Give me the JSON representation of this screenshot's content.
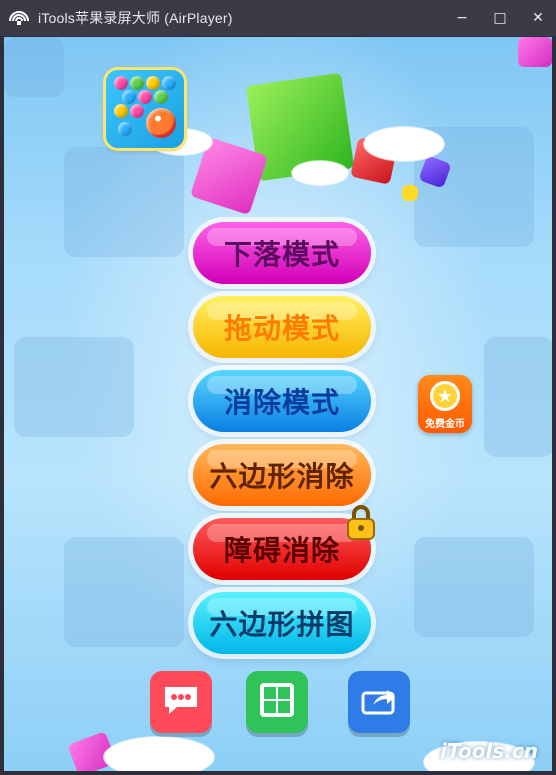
{
  "window": {
    "title": "iTools苹果录屏大师 (AirPlayer)",
    "controls": {
      "minimize": "−",
      "maximize": "□",
      "close": "✕"
    }
  },
  "game": {
    "logo_icon": "bubble-game-logo",
    "modes": [
      {
        "label": "下落模式",
        "color_top": "#ff62e8",
        "color_bottom": "#d100b6",
        "text_color": "#5a0b5f",
        "locked": false
      },
      {
        "label": "拖动模式",
        "color_top": "#fff160",
        "color_bottom": "#f7b500",
        "text_color": "#ff7a00",
        "locked": false
      },
      {
        "label": "消除模式",
        "color_top": "#59d7ff",
        "color_bottom": "#0a7fe3",
        "text_color": "#093c9c",
        "locked": false
      },
      {
        "label": "六边形消除",
        "color_top": "#ffb85a",
        "color_bottom": "#ff6a00",
        "text_color": "#5f2300",
        "locked": false
      },
      {
        "label": "障碍消除",
        "color_top": "#ff5b5b",
        "color_bottom": "#e00000",
        "text_color": "#5a0000",
        "locked": true
      },
      {
        "label": "六边形拼图",
        "color_top": "#57f2ff",
        "color_bottom": "#00b6e8",
        "text_color": "#0b3b6b",
        "locked": false
      }
    ],
    "free_coins_label": "免费金币",
    "free_coins_icon": "star-icon",
    "bottom_buttons": [
      {
        "name": "chat-icon",
        "color": "#ff4a5a"
      },
      {
        "name": "puzzle-icon",
        "color": "#30c35a"
      },
      {
        "name": "share-icon",
        "color": "#2f7be8"
      }
    ],
    "watermark": "iTools.cn"
  }
}
